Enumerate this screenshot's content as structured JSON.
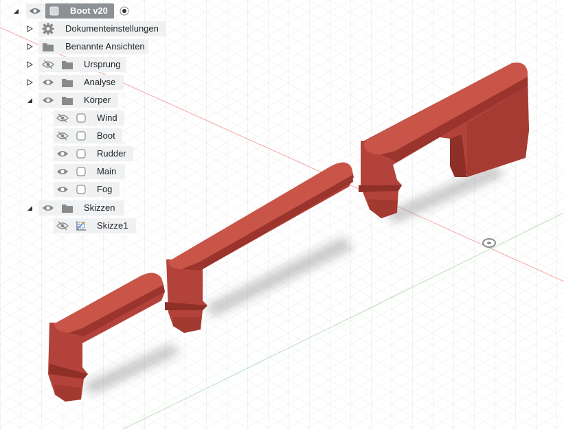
{
  "browser": {
    "root": {
      "label": "Boot v20"
    },
    "items": [
      {
        "id": "dokumenteinstellungen",
        "label": "Dokumenteinstellungen",
        "icon": "gear-icon"
      },
      {
        "id": "benannte-ansichten",
        "label": "Benannte Ansichten",
        "icon": "folder-icon"
      },
      {
        "id": "ursprung",
        "label": "Ursprung",
        "icon": "folder-icon",
        "visibility": "hidden"
      },
      {
        "id": "analyse",
        "label": "Analyse",
        "icon": "folder-icon",
        "visibility": "visible"
      },
      {
        "id": "koerper",
        "label": "Körper",
        "icon": "folder-icon",
        "visibility": "visible",
        "expanded": true,
        "children": [
          {
            "id": "wind",
            "label": "Wind",
            "icon": "body-icon",
            "visibility": "hidden"
          },
          {
            "id": "boot",
            "label": "Boot",
            "icon": "body-icon",
            "visibility": "hidden"
          },
          {
            "id": "rudder",
            "label": "Rudder",
            "icon": "body-icon",
            "visibility": "visible"
          },
          {
            "id": "main",
            "label": "Main",
            "icon": "body-icon",
            "visibility": "visible"
          },
          {
            "id": "fog",
            "label": "Fog",
            "icon": "body-icon",
            "visibility": "visible"
          }
        ]
      },
      {
        "id": "skizzen",
        "label": "Skizzen",
        "icon": "folder-icon",
        "visibility": "visible",
        "expanded": true,
        "children": [
          {
            "id": "skizze1",
            "label": "Skizze1",
            "icon": "sketch-icon",
            "visibility": "hidden"
          }
        ]
      }
    ]
  },
  "colors": {
    "part": "#b3433a",
    "part_light": "#c24f44",
    "part_dark": "#8e2f28",
    "grid": "#e3e3e3",
    "axis_x": "#f0a0a0",
    "axis_z": "#a8dca8",
    "chip": "#8d9094"
  }
}
